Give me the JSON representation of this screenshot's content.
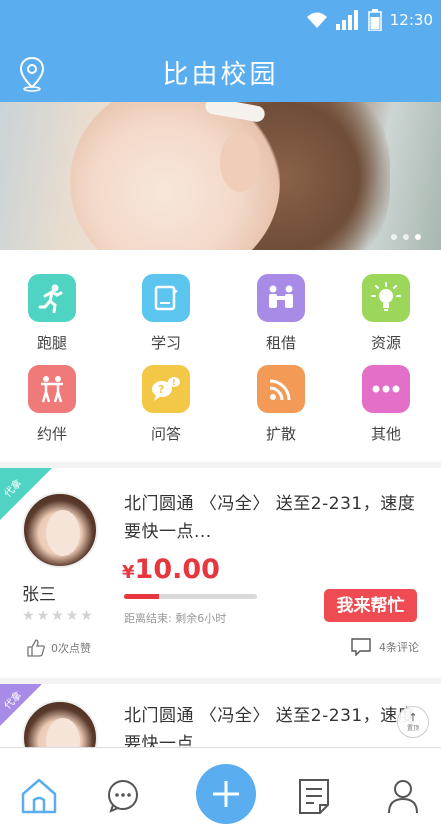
{
  "status": {
    "time": "12:30"
  },
  "header": {
    "title": "比由校园"
  },
  "banner": {
    "slide_count": 3,
    "active_slide": 3
  },
  "categories": [
    {
      "label": "跑腿",
      "icon": "running-icon",
      "color": "#4fd4c3"
    },
    {
      "label": "学习",
      "icon": "book-icon",
      "color": "#5bc4ef"
    },
    {
      "label": "租借",
      "icon": "people-exchange-icon",
      "color": "#a88be6"
    },
    {
      "label": "资源",
      "icon": "lightbulb-icon",
      "color": "#9cd65a"
    },
    {
      "label": "约伴",
      "icon": "dancing-couple-icon",
      "color": "#f07a7a"
    },
    {
      "label": "问答",
      "icon": "question-bubble-icon",
      "color": "#f3c846"
    },
    {
      "label": "扩散",
      "icon": "broadcast-icon",
      "color": "#f29a56"
    },
    {
      "label": "其他",
      "icon": "more-dots-icon",
      "color": "#e46fc8"
    }
  ],
  "cards": [
    {
      "tag": "代拿",
      "tag_color": "#4fd4c3",
      "name": "张三",
      "task": "北门圆通 〈冯全〉 送至2-231，速度要快一点...",
      "currency": "¥",
      "price": "10.00",
      "progress": 0.26,
      "remaining": "距离结束:  剩余6小时",
      "help_label": "我来帮忙",
      "likes": "0次点赞",
      "comments": "4条评论",
      "rating": 0
    },
    {
      "tag": "代拿",
      "tag_color": "#a88be6",
      "task": "北门圆通 〈冯全〉 送至2-231，速度要快一点"
    }
  ],
  "float_top": {
    "label": "置顶"
  },
  "nav": [
    "home-icon",
    "chat-icon",
    "add-icon",
    "list-icon",
    "user-icon"
  ],
  "accent": "#5aaef0",
  "price_color": "#e8363f"
}
